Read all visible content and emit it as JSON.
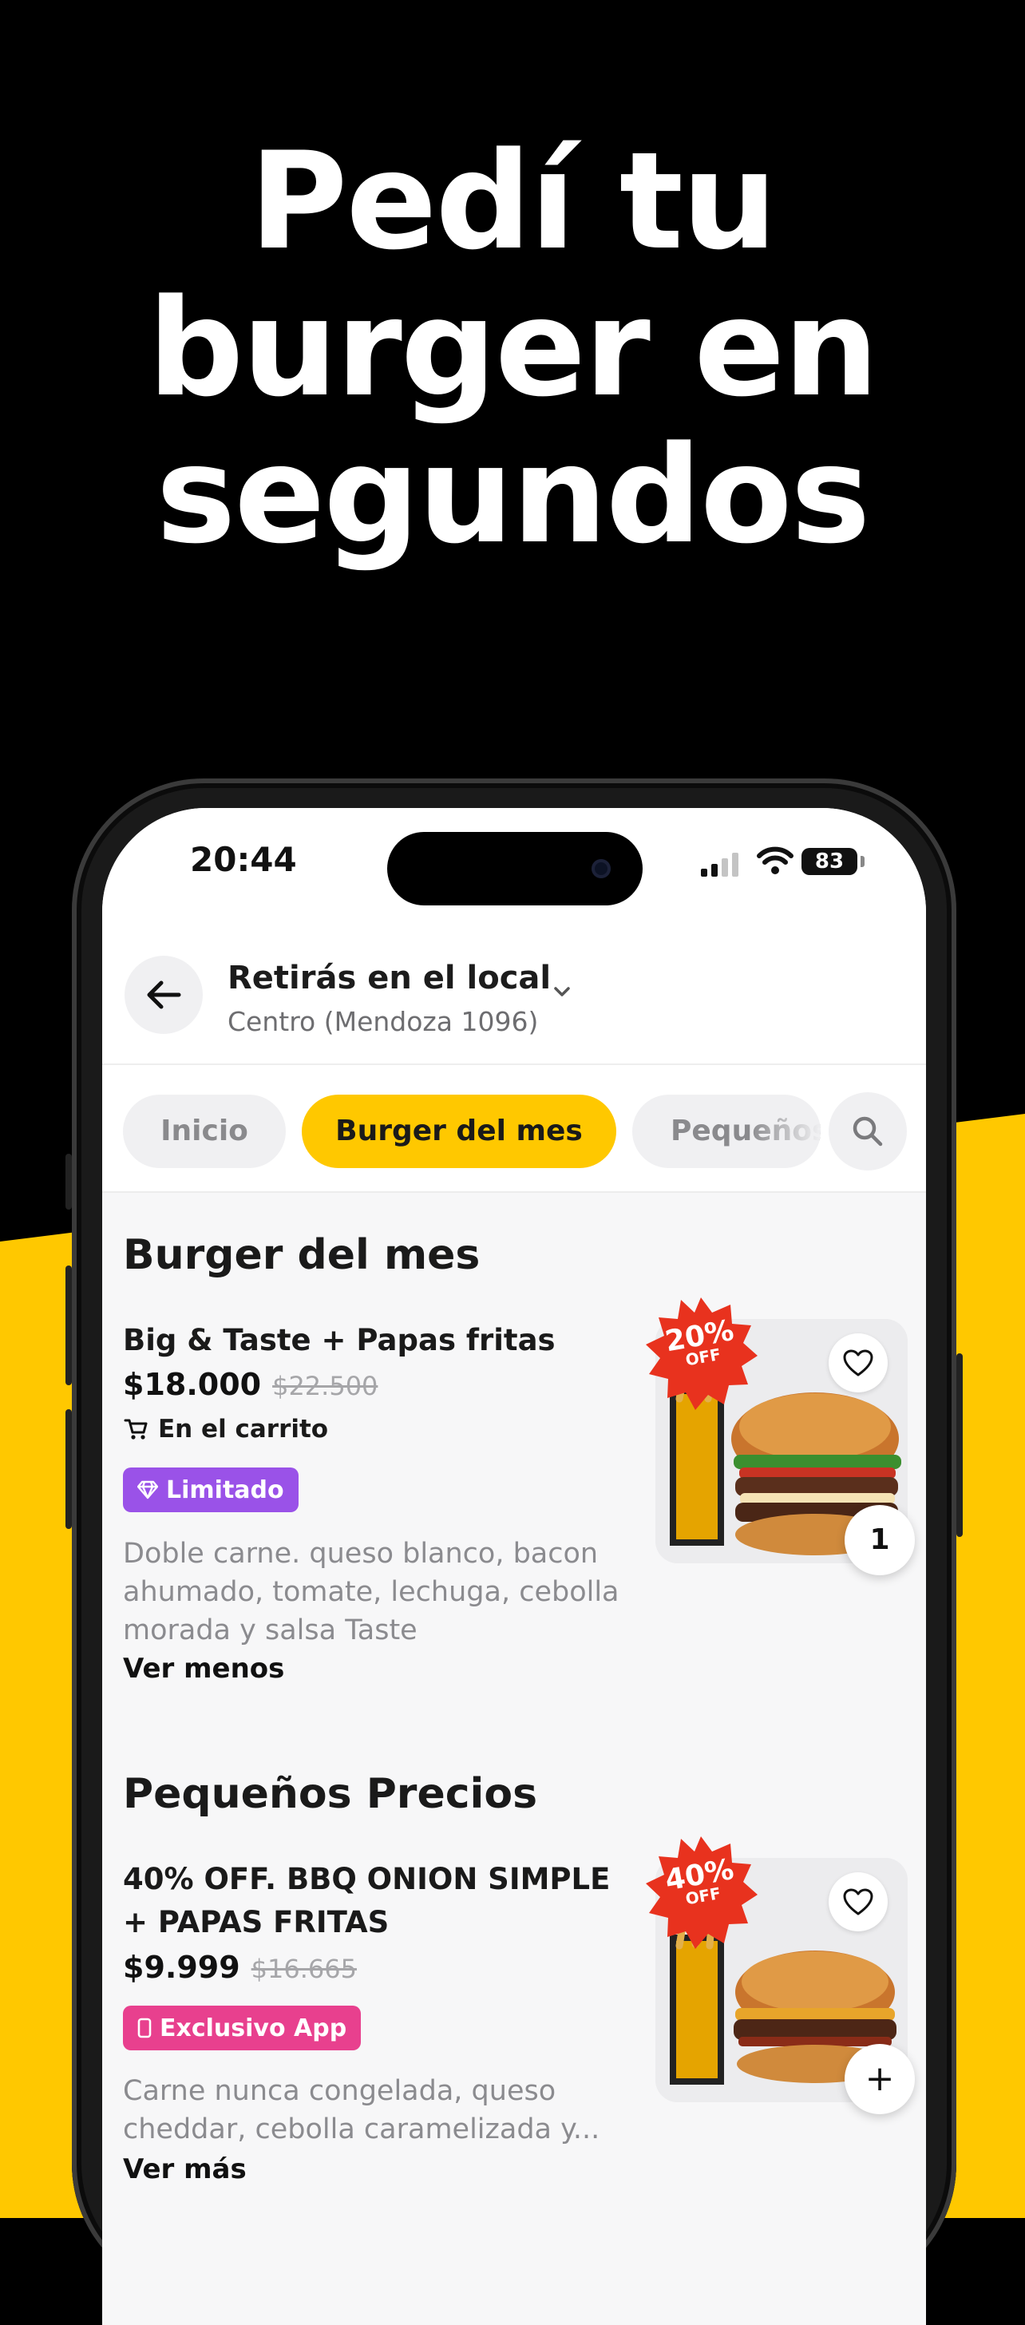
{
  "promo": {
    "headline_lines": [
      "Pedí tu",
      "burger en",
      "segundos"
    ]
  },
  "status_bar": {
    "time": "20:44",
    "battery": "83"
  },
  "header": {
    "title": "Retirás en el local",
    "subtitle": "Centro (Mendoza 1096)"
  },
  "tabs": [
    {
      "label": "Inicio",
      "active": false
    },
    {
      "label": "Burger del mes",
      "active": true
    },
    {
      "label": "Pequeños",
      "active": false
    }
  ],
  "sections": [
    {
      "title": "Burger del mes",
      "item": {
        "name": "Big & Taste + Papas fritas",
        "price": "$18.000",
        "old_price": "$22.500",
        "cart_label": "En el carrito",
        "badge": "Limitado",
        "description": "Doble carne. queso blanco, bacon ahumado, tomate, lechuga, cebolla morada y salsa Taste",
        "toggle": "Ver menos",
        "discount_pct": "20%",
        "discount_off": "OFF",
        "quantity": "1"
      }
    },
    {
      "title": "Pequeños Precios",
      "item": {
        "name": "40% OFF. BBQ ONION SIMPLE + PAPAS FRITAS",
        "price": "$9.999",
        "old_price": "$16.665",
        "badge": "Exclusivo App",
        "description": "Carne nunca congelada, queso cheddar, cebolla caramelizada y...",
        "toggle": "Ver más",
        "discount_pct": "40%",
        "discount_off": "OFF",
        "add_symbol": "+"
      }
    }
  ],
  "colors": {
    "accent_yellow": "#ffc800",
    "background_black": "#000000",
    "badge_purple": "#9a52e8",
    "badge_pink": "#e8408e",
    "discount_red": "#e8321e"
  }
}
